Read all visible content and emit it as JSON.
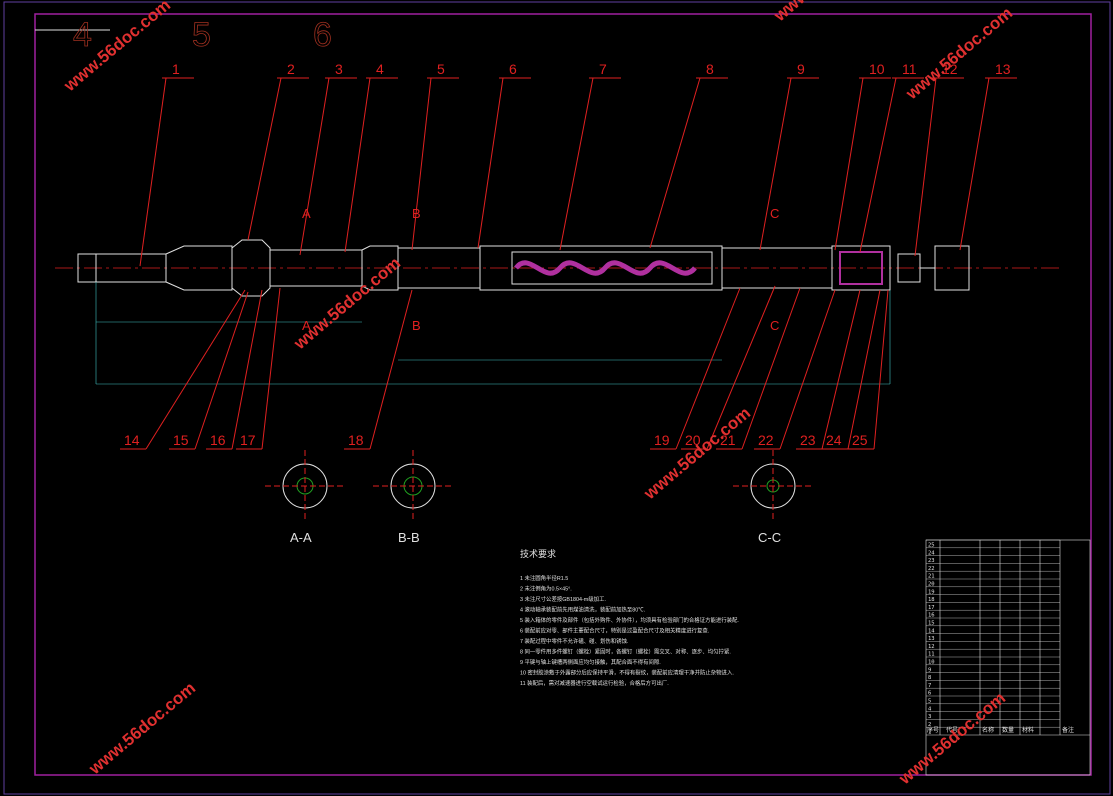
{
  "colors": {
    "background": "#000000",
    "frame": "#a0209f",
    "leader": "#e02020",
    "geometry": "#e0e0e0",
    "dimension": "#40c0c0",
    "fill": "#b0309f",
    "hatch": "#20a020",
    "watermark": "#e03030"
  },
  "zone_numbers": [
    "4",
    "5",
    "6"
  ],
  "top_balloons": [
    "1",
    "2",
    "3",
    "4",
    "5",
    "6",
    "7",
    "8",
    "9",
    "10",
    "11",
    "12",
    "13"
  ],
  "bottom_balloons": [
    "14",
    "15",
    "16",
    "17",
    "18",
    "19",
    "20",
    "21",
    "22",
    "23",
    "24",
    "25"
  ],
  "section_marks": {
    "a_top": "A",
    "a_bottom": "A",
    "b_top": "B",
    "b_bottom": "B",
    "c_top": "C",
    "c_bottom": "C"
  },
  "section_views": [
    "A-A",
    "B-B",
    "C-C"
  ],
  "watermark": "www.56doc.com",
  "tech_requirements": {
    "title": "技术要求",
    "lines": [
      "1 未注圆角半径R1.5",
      "2 未注倒角为0.5×45°.",
      "3 未注尺寸公差按GB1804-m级加工.",
      "4 滚动轴承装配前先用煤油清洗，装配前加热至80℃.",
      "5 装入箱体的零件及部件（包括外购件、外协件），均须具有检验部门的合格证方能进行装配.",
      "6 装配前应对零、部件主要配合尺寸，特别是过盈配合尺寸及相关精度进行复查.",
      "7 装配过程中零件不允许磕、碰、划伤和锈蚀.",
      "8 同一零件用多件螺钉（螺栓）紧固时，各螺钉（螺栓）需交叉、对称、逐步、均匀拧紧.",
      "9 平键与轴上键槽两侧面应均匀接触，其配合面不得有间隙.",
      "10 密封胶涂敷于外露部分后应保持平滑，不得有裂纹，装配前应清理干净并防止杂物进入.",
      "11 装配后，需对减速器进行空载试运行检验，合格后方可出厂."
    ]
  },
  "title_block": {
    "row_numbers": [
      "25",
      "24",
      "23",
      "22",
      "21",
      "20",
      "19",
      "18",
      "17",
      "16",
      "15",
      "14",
      "13",
      "12",
      "11",
      "10",
      "9",
      "8",
      "7",
      "6",
      "5",
      "4",
      "3",
      "2",
      "1"
    ],
    "header": [
      "序号",
      "代号",
      "名称",
      "数量",
      "材料",
      "备注"
    ]
  }
}
